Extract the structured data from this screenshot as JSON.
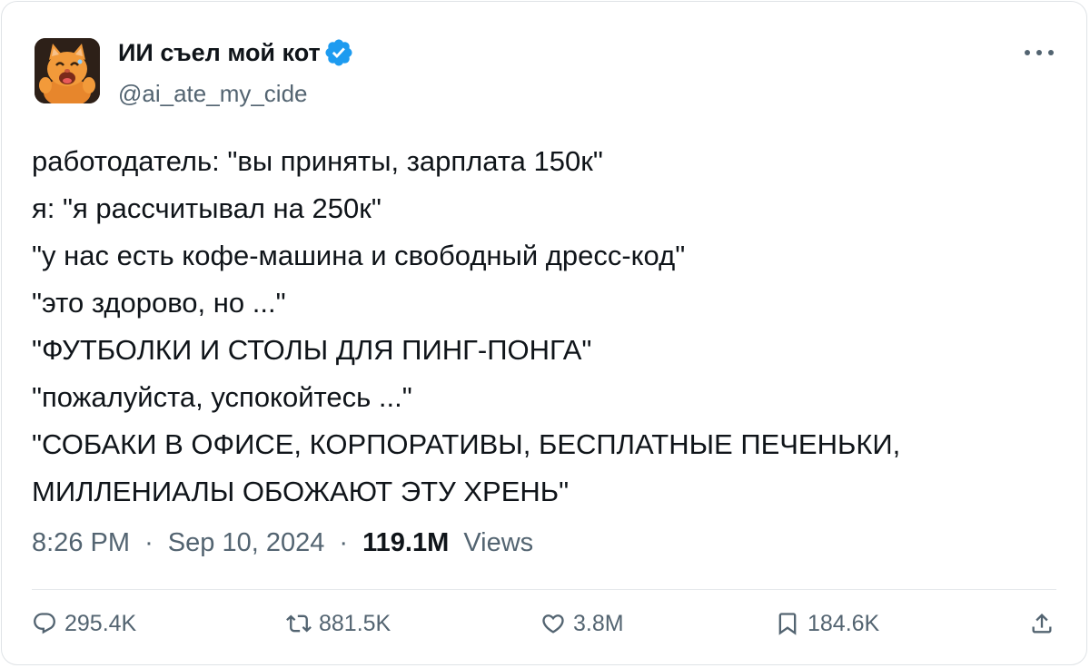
{
  "author": {
    "display_name": "ИИ съел мой кот",
    "handle": "@ai_ate_my_cide",
    "verified": true,
    "avatar_icon": "cartoon-orange-cat-avatar"
  },
  "tweet": {
    "lines": [
      "работодатель: \"вы приняты, зарплата 150к\"",
      "я: \"я рассчитывал на 250к\"",
      "\"у нас есть кофе-машина и свободный дресс-код\"",
      "\"это здорово, но ...\"",
      "\"ФУТБОЛКИ И СТОЛЫ ДЛЯ ПИНГ-ПОНГА\"",
      "\"пожалуйста, успокойтесь ...\"",
      "\"СОБАКИ В ОФИСЕ, КОРПОРАТИВЫ, БЕСПЛАТНЫЕ ПЕЧЕНЬКИ,",
      "МИЛЛЕНИАЛЫ ОБОЖАЮТ ЭТУ ХРЕНЬ\""
    ]
  },
  "meta": {
    "time": "8:26 PM",
    "date": "Sep 10, 2024",
    "separator": "·",
    "views_count": "119.1M",
    "views_label": "Views"
  },
  "actions": {
    "replies": "295.4K",
    "retweets": "881.5K",
    "likes": "3.8M",
    "bookmarks": "184.6K"
  },
  "colors": {
    "text_primary": "#0f1419",
    "text_secondary": "#536471",
    "verified_blue": "#1d9bf0",
    "border": "#dfe3e6"
  }
}
